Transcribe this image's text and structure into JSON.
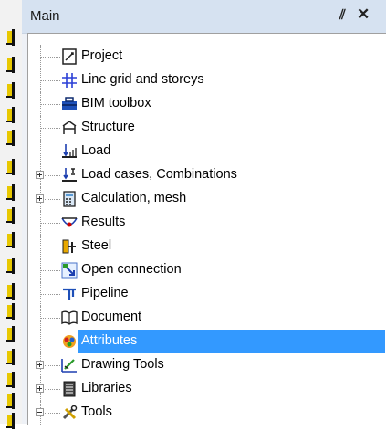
{
  "panel": {
    "title": "Main",
    "pin_glyph": "⫽",
    "close_glyph": "✕"
  },
  "toolbar_icons": [
    "tool-a-icon",
    "tool-b-icon",
    "tool-c-icon",
    "tool-d-icon",
    "tool-e-icon",
    "tool-f-icon",
    "tool-g-icon",
    "tool-h-icon",
    "tool-i-icon",
    "tool-j-icon",
    "tool-k-icon",
    "tool-l-icon",
    "tool-m-icon",
    "tool-n-icon",
    "tool-o-icon",
    "tool-p-icon",
    "tool-q-icon",
    "tool-r-icon"
  ],
  "tree": {
    "items": [
      {
        "label": "Project",
        "icon": "project-icon",
        "expander": "none",
        "selected": false
      },
      {
        "label": "Line grid and storeys",
        "icon": "grid-icon",
        "expander": "none",
        "selected": false
      },
      {
        "label": "BIM toolbox",
        "icon": "toolbox-icon",
        "expander": "none",
        "selected": false
      },
      {
        "label": "Structure",
        "icon": "structure-icon",
        "expander": "none",
        "selected": false
      },
      {
        "label": "Load",
        "icon": "load-icon",
        "expander": "none",
        "selected": false
      },
      {
        "label": "Load cases, Combinations",
        "icon": "load-cases-icon",
        "expander": "plus",
        "selected": false
      },
      {
        "label": "Calculation, mesh",
        "icon": "calculator-icon",
        "expander": "plus",
        "selected": false
      },
      {
        "label": "Results",
        "icon": "results-icon",
        "expander": "none",
        "selected": false
      },
      {
        "label": "Steel",
        "icon": "steel-icon",
        "expander": "none",
        "selected": false
      },
      {
        "label": "Open connection",
        "icon": "open-connection-icon",
        "expander": "none",
        "selected": false
      },
      {
        "label": "Pipeline",
        "icon": "pipeline-icon",
        "expander": "none",
        "selected": false
      },
      {
        "label": "Document",
        "icon": "document-icon",
        "expander": "none",
        "selected": false
      },
      {
        "label": "Attributes",
        "icon": "attributes-icon",
        "expander": "none",
        "selected": true
      },
      {
        "label": "Drawing Tools",
        "icon": "drawing-tools-icon",
        "expander": "plus",
        "selected": false
      },
      {
        "label": "Libraries",
        "icon": "libraries-icon",
        "expander": "plus",
        "selected": false
      },
      {
        "label": "Tools",
        "icon": "tools-icon",
        "expander": "minus",
        "selected": false
      }
    ]
  },
  "colors": {
    "header_bg": "#d6e2f1",
    "selection": "#3399ff",
    "tree_bg": "#ffffff"
  }
}
